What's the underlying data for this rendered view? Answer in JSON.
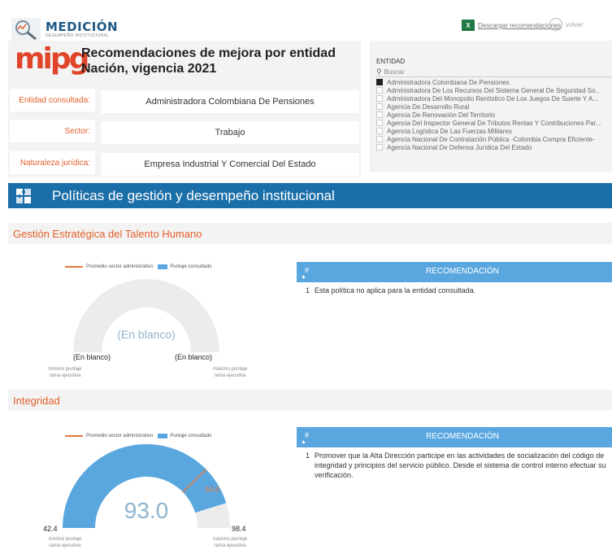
{
  "header": {
    "logo_title": "MEDICIÓN",
    "logo_subtitle": "DESEMPEÑO INSTITUCIONAL",
    "download_label": "Descargar recomendaciones",
    "back_label": "volver",
    "brand": "mipg",
    "report_title": "Recomendaciones de mejora por entidad Nación, vigencia 2021"
  },
  "info": [
    {
      "label": "Entidad consultada:",
      "value": "Administradora Colombiana De Pensiones"
    },
    {
      "label": "Sector:",
      "value": "Trabajo"
    },
    {
      "label": "Naturaleza jurídica:",
      "value": "Empresa Industrial Y Comercial Del Estado"
    }
  ],
  "slicer": {
    "header": "ENTIDAD",
    "search_placeholder": "Buscar",
    "items": [
      {
        "label": "Administradora Colombiana De Pensiones",
        "selected": true
      },
      {
        "label": "Administradora De Los Recursos Del Sistema General De Seguridad So...",
        "selected": false
      },
      {
        "label": "Administradora Del Monopolio Rentístico De Los Juegos De Suerte Y A...",
        "selected": false
      },
      {
        "label": "Agencia De Desarrollo Rural",
        "selected": false
      },
      {
        "label": "Agencia De Renovación Del Territorio",
        "selected": false
      },
      {
        "label": "Agencia Del Inspector General De Tributos Rentas Y Contribuciones Par...",
        "selected": false
      },
      {
        "label": "Agencia Logística De Las Fuerzas Militares",
        "selected": false
      },
      {
        "label": "Agencia Nacional De Contratación Pública -Colombia Compra Eficiente-",
        "selected": false
      },
      {
        "label": "Agencia Nacional De Defensa Jurídica Del Estado",
        "selected": false
      }
    ]
  },
  "banner": {
    "title": "Políticas de gestión y desempeño institucional"
  },
  "colors": {
    "accent_orange": "#e2602b",
    "gauge_blue": "#5aa7e0",
    "banner_blue": "#1b6fa8",
    "sector_line": "#e07a3c"
  },
  "legend": {
    "sector": "Promedio sector administrativo",
    "score": "Puntaje consultado"
  },
  "table_headers": {
    "num": "#",
    "rec": "RECOMENDACIÓN"
  },
  "sections": [
    {
      "title": "Gestión Estratégica del Talento Humano",
      "gauge": {
        "center_text": "(En blanco)",
        "min_text": "(En blanco)",
        "max_text": "(En blanco)",
        "min_caption_1": "mínimo puntaje",
        "min_caption_2": "rama ejecutiva",
        "max_caption_1": "máximo puntaje",
        "max_caption_2": "rama ejecutiva"
      },
      "recommendations": [
        {
          "num": "1",
          "text": "Esta política no aplica para la entidad consultada."
        }
      ]
    },
    {
      "title": "Integridad",
      "gauge": {
        "center_text": "93.0",
        "min_text": "42.4",
        "max_text": "98.4",
        "sector_text": "84.6",
        "min": 42.4,
        "max": 98.4,
        "value": 93.0,
        "sector": 84.6,
        "min_caption_1": "mínimo puntaje",
        "min_caption_2": "rama ejecutiva",
        "max_caption_1": "máximo puntaje",
        "max_caption_2": "rama ejecutiva"
      },
      "recommendations": [
        {
          "num": "1",
          "text": "Promover que la Alta Dirección participe en las actividades de socialización del código de integridad y principios del servicio público. Desde el sistema de control interno efectuar su verificación."
        }
      ]
    }
  ]
}
